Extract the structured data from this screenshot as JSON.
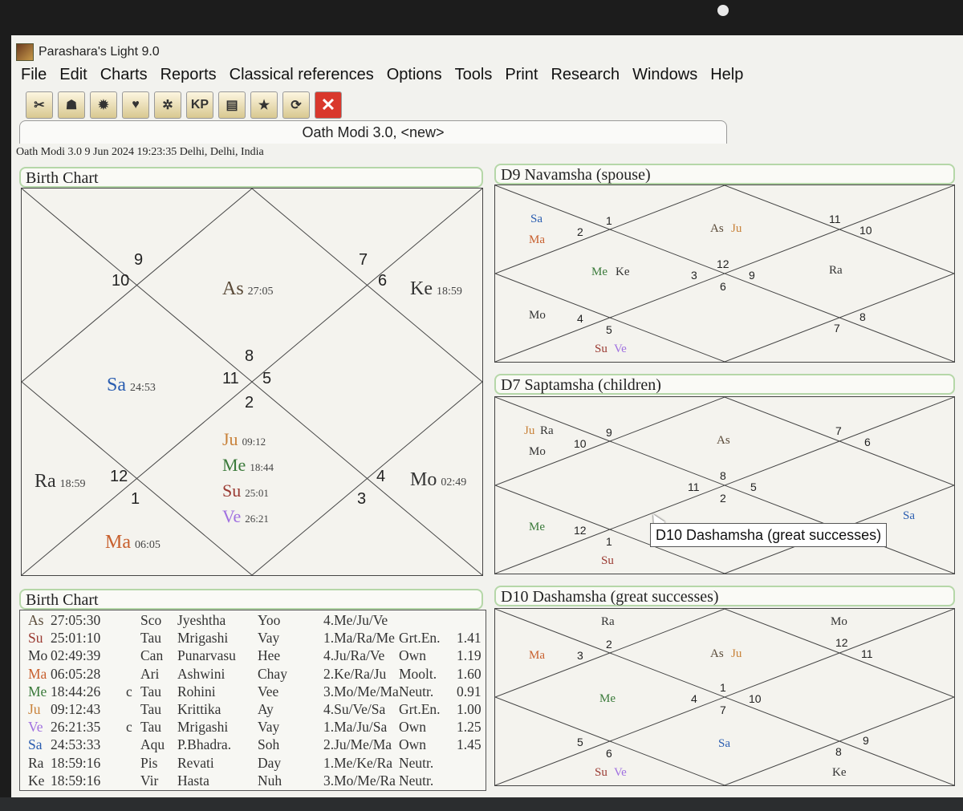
{
  "app": {
    "title": "Parashara's Light 9.0"
  },
  "menu": [
    "File",
    "Edit",
    "Charts",
    "Reports",
    "Classical references",
    "Options",
    "Tools",
    "Print",
    "Research",
    "Windows",
    "Help"
  ],
  "toolbar": [
    {
      "name": "tools-icon",
      "glyph": "✂"
    },
    {
      "name": "person-icon",
      "glyph": "☗"
    },
    {
      "name": "sun-icon",
      "glyph": "✹"
    },
    {
      "name": "heart-icon",
      "glyph": "♥"
    },
    {
      "name": "wheel-icon",
      "glyph": "✲"
    },
    {
      "name": "kp-icon",
      "glyph": "KP"
    },
    {
      "name": "report-icon",
      "glyph": "▤"
    },
    {
      "name": "star-icon",
      "glyph": "★"
    },
    {
      "name": "refresh-icon",
      "glyph": "⟳"
    },
    {
      "name": "close-icon",
      "glyph": "✕"
    }
  ],
  "tab": "Oath Modi 3.0,  <new>",
  "info": "Oath Modi 3.0 9 Jun 2024 19:23:35  Delhi, Delhi, India",
  "colors": {
    "Sa": "#2a5db0",
    "Mo": "#333333",
    "Ma": "#c8602e",
    "Su": "#9a3a32",
    "Ve": "#a070e0",
    "Ju": "#c8823a",
    "Me": "#3a7a3a",
    "Ra": "#333333",
    "Ke": "#333333",
    "As": "#5a4a38"
  },
  "birth_chart": {
    "title": "Birth Chart",
    "houses": [
      "9",
      "10",
      "7",
      "6",
      "8",
      "11",
      "5",
      "2",
      "12",
      "1",
      "4",
      "3"
    ],
    "planets": [
      {
        "p": "As",
        "d": "27:05"
      },
      {
        "p": "Ke",
        "d": "18:59"
      },
      {
        "p": "Sa",
        "d": "24:53"
      },
      {
        "p": "Ju",
        "d": "09:12"
      },
      {
        "p": "Me",
        "d": "18:44"
      },
      {
        "p": "Su",
        "d": "25:01"
      },
      {
        "p": "Ve",
        "d": "26:21"
      },
      {
        "p": "Ra",
        "d": "18:59"
      },
      {
        "p": "Mo",
        "d": "02:49"
      },
      {
        "p": "Ma",
        "d": "06:05"
      }
    ]
  },
  "d9": {
    "title": "D9 Navamsha  (spouse)",
    "houses": [
      "1",
      "2",
      "11",
      "10",
      "12",
      "3",
      "9",
      "6",
      "4",
      "5",
      "8",
      "7"
    ],
    "planets": [
      "Sa",
      "Ma",
      "As",
      "Ju",
      "Me",
      "Ke",
      "Ra",
      "Mo",
      "Su",
      "Ve"
    ]
  },
  "d7": {
    "title": "D7 Saptamsha  (children)",
    "houses": [
      "9",
      "10",
      "7",
      "6",
      "8",
      "11",
      "5",
      "2",
      "12",
      "1"
    ],
    "planets": [
      "Ju",
      "Ra",
      "Mo",
      "As",
      "Me",
      "Su",
      "Sa"
    ]
  },
  "d10": {
    "title": "D10 Dashamsha  (great successes)",
    "houses": [
      "2",
      "3",
      "12",
      "11",
      "1",
      "4",
      "10",
      "7",
      "5",
      "6",
      "8",
      "9"
    ],
    "planets": [
      "Ra",
      "Mo",
      "Ma",
      "As",
      "Ju",
      "Me",
      "Sa",
      "Su",
      "Ve",
      "Ke"
    ]
  },
  "tooltip": "D10 Dashamsha  (great successes)",
  "table": {
    "title": "Birth Chart",
    "rows": [
      [
        "As",
        "27:05:30",
        "",
        "Sco",
        "Jyeshtha",
        "Yoo",
        "4.Me/Ju/Ve",
        "",
        ""
      ],
      [
        "Su",
        "25:01:10",
        "",
        "Tau",
        "Mrigashi",
        "Vay",
        "1.Ma/Ra/Me",
        "Grt.En.",
        "1.41"
      ],
      [
        "Mo",
        "02:49:39",
        "",
        "Can",
        "Punarvasu",
        "Hee",
        "4.Ju/Ra/Ve",
        "Own",
        "1.19"
      ],
      [
        "Ma",
        "06:05:28",
        "",
        "Ari",
        "Ashwini",
        "Chay",
        "2.Ke/Ra/Ju",
        "Moolt.",
        "1.60"
      ],
      [
        "Me",
        "18:44:26",
        "c",
        "Tau",
        "Rohini",
        "Vee",
        "3.Mo/Me/Ma",
        "Neutr.",
        "0.91"
      ],
      [
        "Ju",
        "09:12:43",
        "",
        "Tau",
        "Krittika",
        "Ay",
        "4.Su/Ve/Sa",
        "Grt.En.",
        "1.00"
      ],
      [
        "Ve",
        "26:21:35",
        "c",
        "Tau",
        "Mrigashi",
        "Vay",
        "1.Ma/Ju/Sa",
        "Own",
        "1.25"
      ],
      [
        "Sa",
        "24:53:33",
        "",
        "Aqu",
        "P.Bhadra.",
        "Soh",
        "2.Ju/Me/Ma",
        "Own",
        "1.45"
      ],
      [
        "Ra",
        "18:59:16",
        "",
        "Pis",
        "Revati",
        "Day",
        "1.Me/Ke/Ra",
        "Neutr.",
        ""
      ],
      [
        "Ke",
        "18:59:16",
        "",
        "Vir",
        "Hasta",
        "Nuh",
        "3.Mo/Me/Ra",
        "Neutr.",
        ""
      ]
    ]
  }
}
